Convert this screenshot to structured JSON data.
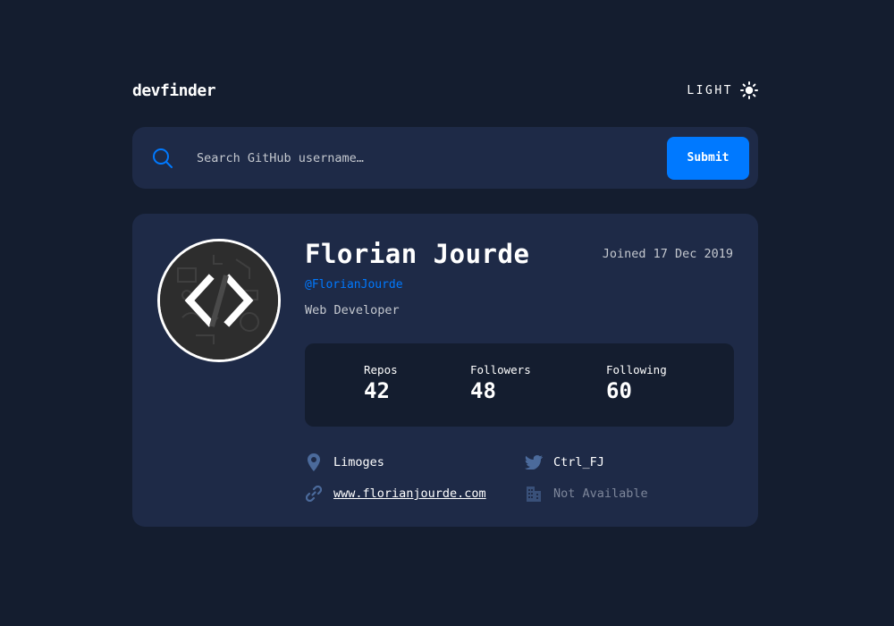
{
  "header": {
    "logo": "devfinder",
    "theme_label": "LIGHT"
  },
  "search": {
    "placeholder": "Search GitHub username…",
    "value": "",
    "submit_label": "Submit"
  },
  "profile": {
    "name": "Florian Jourde",
    "handle": "@FlorianJourde",
    "joined": "Joined 17 Dec 2019",
    "bio": "Web Developer",
    "stats": [
      {
        "label": "Repos",
        "value": "42"
      },
      {
        "label": "Followers",
        "value": "48"
      },
      {
        "label": "Following",
        "value": "60"
      }
    ],
    "location": "Limoges",
    "twitter": "Ctrl_FJ",
    "website": "www.florianjourde.com",
    "company": "Not Available"
  },
  "colors": {
    "background": "#141d2f",
    "card": "#1e2a47",
    "accent": "#0079ff",
    "muted": "#7d869a"
  },
  "icons": {
    "theme": "sun-icon",
    "search": "search-icon",
    "location": "location-pin-icon",
    "twitter": "twitter-icon",
    "website": "link-icon",
    "company": "building-icon"
  }
}
